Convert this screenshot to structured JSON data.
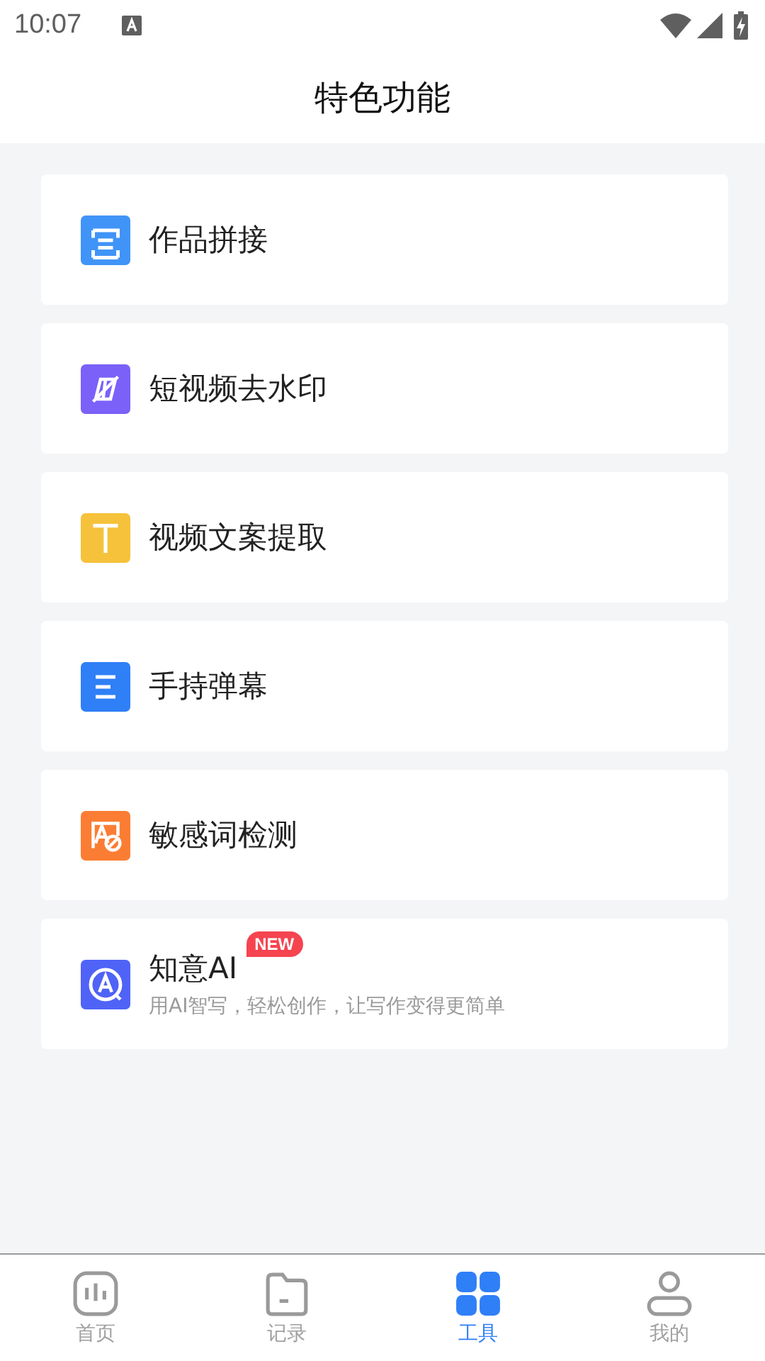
{
  "status_bar": {
    "time": "10:07"
  },
  "header": {
    "title": "特色功能"
  },
  "features": [
    {
      "label": "作品拼接",
      "color": "#4094f7"
    },
    {
      "label": "短视频去水印",
      "color": "#7b61f8"
    },
    {
      "label": "视频文案提取",
      "color": "#f6c23b"
    },
    {
      "label": "手持弹幕",
      "color": "#2f7ff7"
    },
    {
      "label": "敏感词检测",
      "color": "#fb7d33"
    },
    {
      "label": "知意AI",
      "color": "#4f63f7",
      "badge": "NEW",
      "subtitle": "用AI智写，轻松创作，让写作变得更简单"
    }
  ],
  "tabs": [
    {
      "label": "首页",
      "selected": false
    },
    {
      "label": "记录",
      "selected": false
    },
    {
      "label": "工具",
      "selected": true
    },
    {
      "label": "我的",
      "selected": false
    }
  ]
}
